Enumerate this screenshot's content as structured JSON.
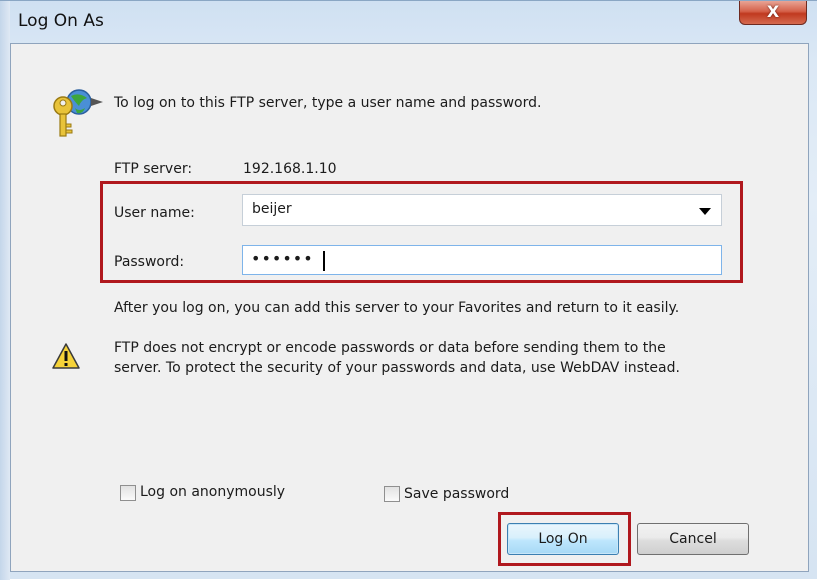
{
  "window": {
    "title": "Log On As",
    "close_label": "X"
  },
  "dialog": {
    "intro_text": "To log on to this FTP server, type a user name and password.",
    "ftp_server_label": "FTP server:",
    "ftp_server_value": "192.168.1.10",
    "user_name_label": "User name:",
    "user_name_value": "beijer",
    "password_label": "Password:",
    "password_masked": "••••••",
    "after_logon_text": "After you log on, you can add this server to your Favorites and return to it easily.",
    "warning_line1": "FTP does not encrypt or encode passwords or data before sending them to the",
    "warning_line2": "server.  To protect the security of your passwords and data, use WebDAV instead.",
    "anonymous_checkbox_label": "Log on anonymously",
    "anonymous_checked": false,
    "save_password_checkbox_label": "Save password",
    "save_password_checked": false,
    "logon_button_label": "Log On",
    "cancel_button_label": "Cancel"
  },
  "icons": {
    "key": "key-globe-icon",
    "warning": "warning-icon",
    "dropdown": "chevron-down-icon"
  },
  "colors": {
    "highlight": "#b0181e",
    "close_button": "#c7432a",
    "focus_border": "#7eb4ea"
  }
}
